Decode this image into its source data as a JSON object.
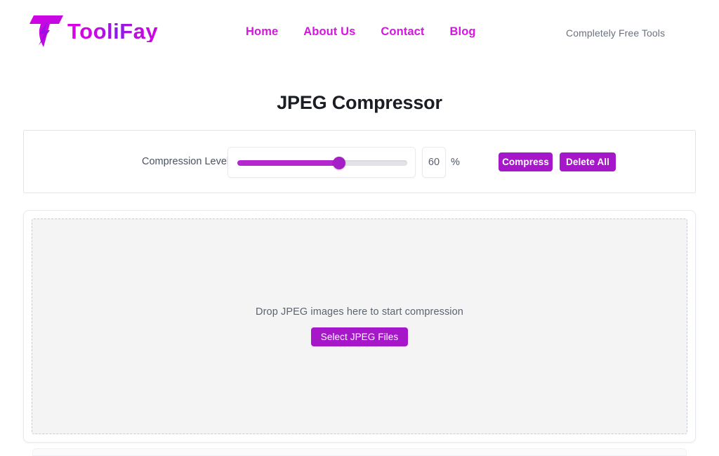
{
  "header": {
    "logo_icon": "lightning-t-logo",
    "brand_name": "TooliFay",
    "nav": [
      {
        "label": "Home"
      },
      {
        "label": "About Us"
      },
      {
        "label": "Contact"
      },
      {
        "label": "Blog"
      }
    ],
    "tagline": "Completely Free Tools",
    "brand_gradient_from": "#d800e6",
    "brand_gradient_mid": "#8b1ae8",
    "brand_gradient_to": "#d400e8",
    "nav_link_color": "#d516e0",
    "tagline_color": "#6b7280"
  },
  "page": {
    "title": "JPEG Compressor",
    "title_color": "#1a1d23"
  },
  "controls": {
    "compression_label": "Compression Level",
    "slider": {
      "value": 60,
      "min": 0,
      "max": 100,
      "fill_color": "#b527cf",
      "thumb_color": "#a61fc6",
      "track_color": "#e3e3e7"
    },
    "value_input": {
      "value": "60",
      "placeholder": "60"
    },
    "percent_symbol": "%",
    "compress_button": "Compress",
    "delete_all_button": "Delete All",
    "button_color": "#a517c9"
  },
  "dropzone": {
    "prompt": "Drop JPEG images here to start compression",
    "select_button": "Select JPEG Files",
    "background": "#f4f4f5",
    "border_color": "#c9cdd3"
  }
}
